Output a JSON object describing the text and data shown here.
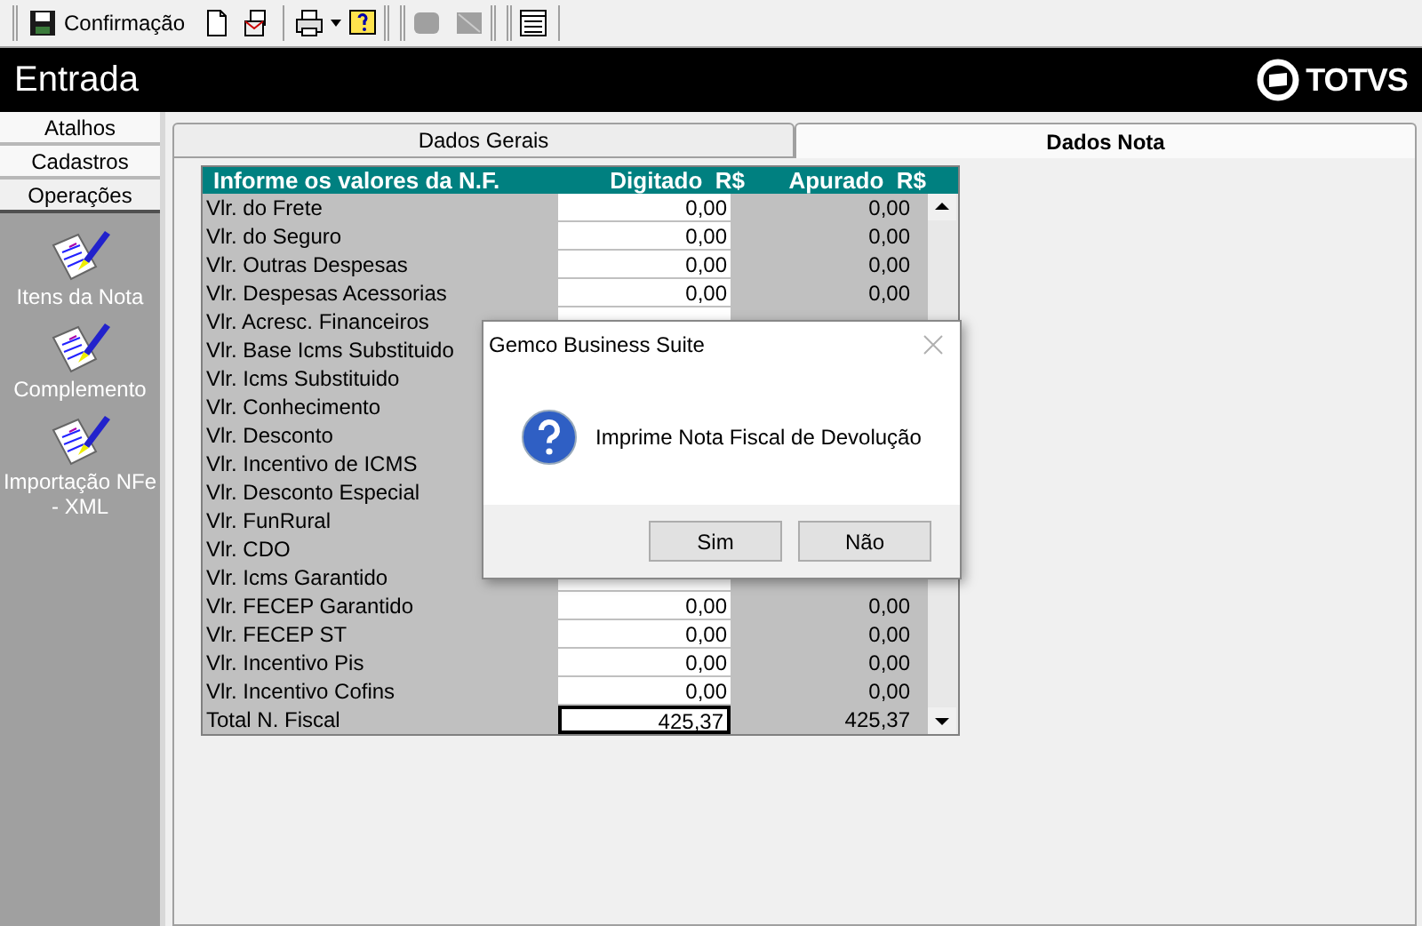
{
  "toolbar": {
    "save_label": "Confirmação",
    "tools": [
      {
        "disabled": false
      },
      {
        "disabled": false
      },
      {
        "disabled": false
      },
      {
        "disabled": false
      },
      {
        "disabled": true
      },
      {
        "disabled": true
      },
      {
        "disabled": false
      }
    ]
  },
  "header": {
    "title": "Entrada",
    "logo": "TOTVS"
  },
  "sidebar": {
    "tabs": [
      {
        "label": "Atalhos",
        "selected": false
      },
      {
        "label": "Cadastros",
        "selected": false
      },
      {
        "label": "Operações",
        "selected": true
      }
    ],
    "items": [
      "Itens da Nota",
      "Complemento",
      "Importação NFe - XML"
    ]
  },
  "tabs": [
    {
      "label": "Dados Gerais",
      "selected": false
    },
    {
      "label": "Dados Nota",
      "selected": true
    }
  ],
  "table": {
    "columns": [
      "Informe os valores da N.F.",
      "Digitado  R$",
      "Apurado  R$"
    ],
    "rows": [
      {
        "label": "Vlr. do Frete",
        "digitado": "0,00",
        "apurado": "0,00"
      },
      {
        "label": "Vlr. do Seguro",
        "digitado": "0,00",
        "apurado": "0,00"
      },
      {
        "label": "Vlr. Outras Despesas",
        "digitado": "0,00",
        "apurado": "0,00"
      },
      {
        "label": "Vlr. Despesas Acessorias",
        "digitado": "0,00",
        "apurado": "0,00"
      },
      {
        "label": "Vlr. Acresc. Financeiros"
      },
      {
        "label": "Vlr. Base Icms Substituido"
      },
      {
        "label": "Vlr. Icms Substituido"
      },
      {
        "label": "Vlr. Conhecimento"
      },
      {
        "label": "Vlr. Desconto"
      },
      {
        "label": "Vlr. Incentivo de ICMS"
      },
      {
        "label": "Vlr. Desconto Especial"
      },
      {
        "label": "Vlr. FunRural"
      },
      {
        "label": "Vlr. CDO"
      },
      {
        "label": "Vlr. Icms Garantido"
      },
      {
        "label": "Vlr. FECEP Garantido",
        "digitado": "0,00",
        "apurado": "0,00"
      },
      {
        "label": "Vlr. FECEP ST",
        "digitado": "0,00",
        "apurado": "0,00"
      },
      {
        "label": "Vlr. Incentivo Pis",
        "digitado": "0,00",
        "apurado": "0,00"
      },
      {
        "label": "Vlr. Incentivo Cofins",
        "digitado": "0,00",
        "apurado": "0,00"
      }
    ],
    "total": {
      "label": "Total N. Fiscal",
      "digitado": "425,37",
      "apurado": "425,37"
    }
  },
  "dialog": {
    "title": "Gemco Business Suite",
    "message": "Imprime Nota Fiscal de Devolução",
    "buttons": [
      "Sim",
      "Não"
    ]
  }
}
